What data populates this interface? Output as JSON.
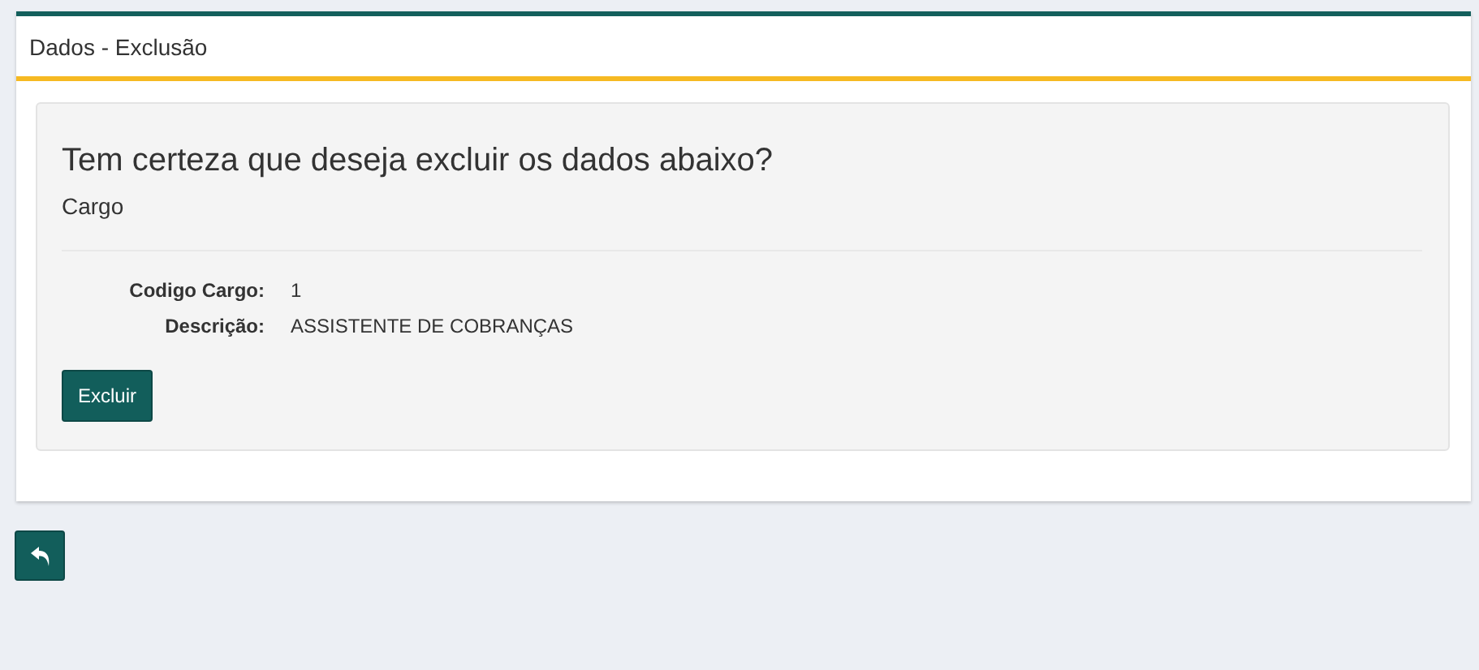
{
  "panel": {
    "title": "Dados - Exclusão"
  },
  "confirmation": {
    "question": "Tem certeza que deseja excluir os dados abaixo?",
    "entity": "Cargo"
  },
  "fields": [
    {
      "label": "Codigo Cargo:",
      "value": "1"
    },
    {
      "label": "Descrição:",
      "value": "ASSISTENTE DE COBRANÇAS"
    }
  ],
  "delete_button": {
    "label": "Excluir"
  }
}
